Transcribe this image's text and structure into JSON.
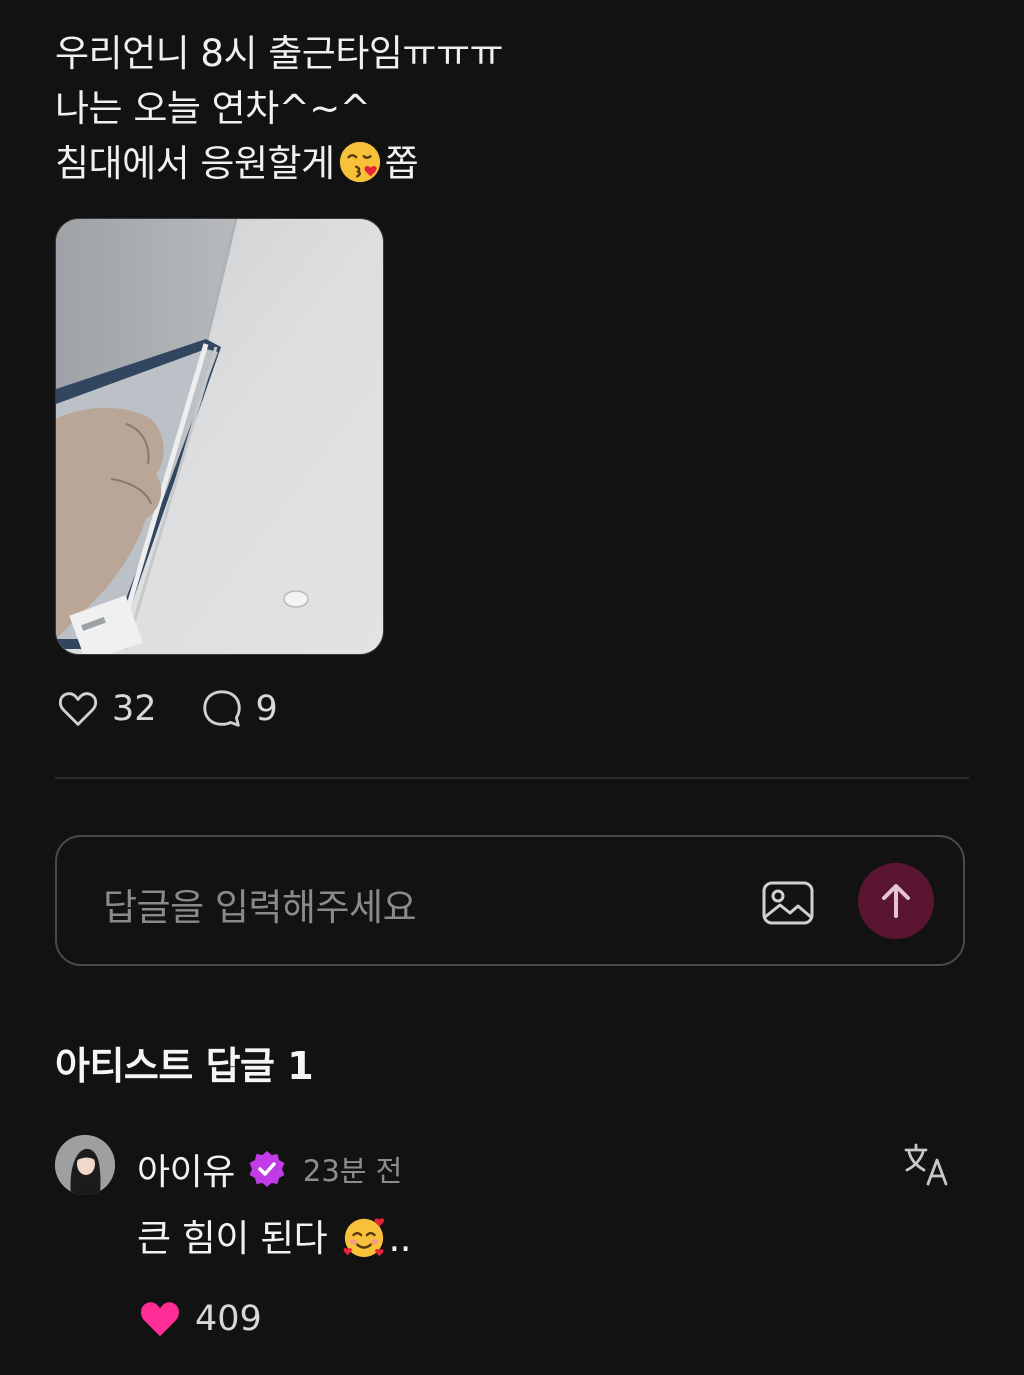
{
  "post": {
    "lines": [
      "우리언니 8시 출근타임ㅠㅠㅠ",
      "나는 오늘 연차^~^",
      "침대에서 응원할게",
      "쫍"
    ],
    "emoji_icon": "kissing-heart-emoji",
    "photo_icon": "ceiling-fist-photo"
  },
  "stats": {
    "likes": "32",
    "comments": "9",
    "like_icon": "heart-outline-icon",
    "comment_icon": "speech-bubble-icon"
  },
  "reply_input": {
    "placeholder": "답글을 입력해주세요",
    "image_icon": "image-icon",
    "send_icon": "arrow-up-icon"
  },
  "artist_section": {
    "title": "아티스트 답글 1"
  },
  "comment": {
    "author": "아이유",
    "time": "23분 전",
    "text": "큰 힘이 된다",
    "text_suffix": "..",
    "likes": "409",
    "verified_icon": "verified-badge-icon",
    "translate_icon": "translate-icon",
    "like_icon": "heart-filled-icon"
  },
  "colors": {
    "background": "#121212",
    "send_button": "#5a1533",
    "heart_pink": "#ff2d95",
    "verified_purple": "#c13be6"
  }
}
